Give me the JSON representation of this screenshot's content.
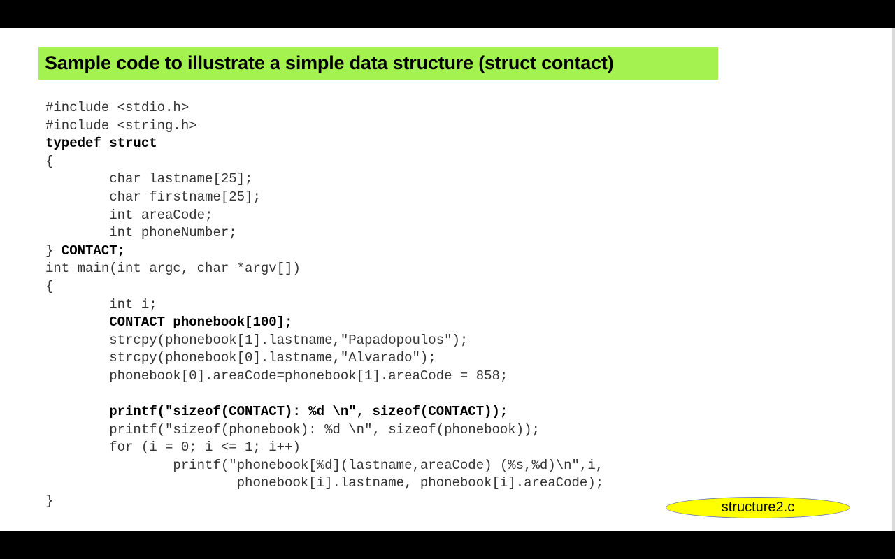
{
  "title": "Sample code to illustrate a simple data structure (struct contact)",
  "code": {
    "l1": "#include <stdio.h>",
    "l2": "#include <string.h>",
    "l3": "typedef struct",
    "l4": "{",
    "l5": "        char lastname[25];",
    "l6": "        char firstname[25];",
    "l7": "        int areaCode;",
    "l8": "        int phoneNumber;",
    "l9_brace": "} ",
    "l9_name": "CONTACT;",
    "l10": "int main(int argc, char *argv[])",
    "l11": "{",
    "l12": "        int i;",
    "l13_indent": "        ",
    "l13": "CONTACT phonebook[100];",
    "l14": "        strcpy(phonebook[1].lastname,\"Papadopoulos\");",
    "l15": "        strcpy(phonebook[0].lastname,\"Alvarado\");",
    "l16": "        phonebook[0].areaCode=phonebook[1].areaCode = 858;",
    "l17": "",
    "l18_indent": "        ",
    "l18": "printf(\"sizeof(CONTACT): %d \\n\", sizeof(CONTACT));",
    "l19": "        printf(\"sizeof(phonebook): %d \\n\", sizeof(phonebook));",
    "l20": "        for (i = 0; i <= 1; i++)",
    "l21": "                printf(\"phonebook[%d](lastname,areaCode) (%s,%d)\\n\",i,",
    "l22": "                        phonebook[i].lastname, phonebook[i].areaCode);",
    "l23": "}"
  },
  "badge": "structure2.c",
  "colors": {
    "title_bg": "#a3f250",
    "badge_bg": "#ffff00",
    "badge_border": "#6e7cb0"
  }
}
